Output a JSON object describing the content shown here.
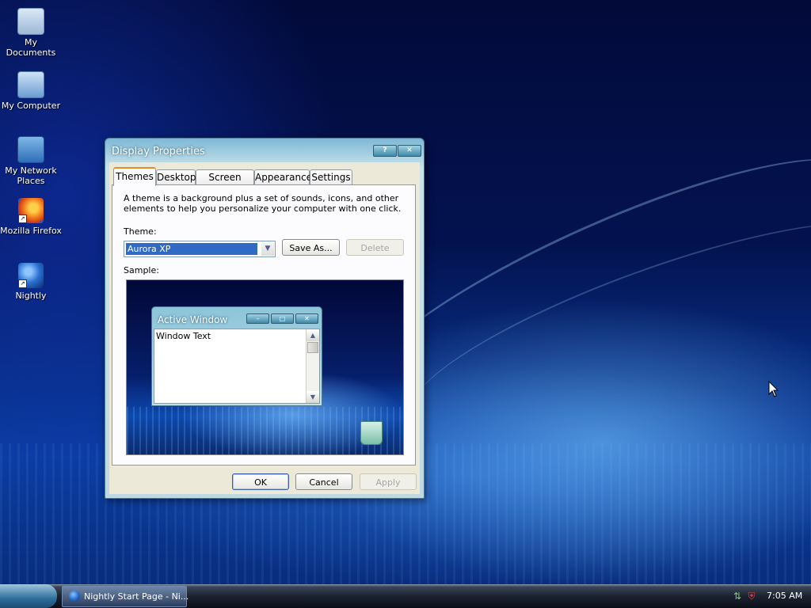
{
  "desktop": {
    "icons": [
      {
        "label": "My Documents",
        "icon": "folder-documents-icon"
      },
      {
        "label": "My Computer",
        "icon": "computer-icon"
      },
      {
        "label": "My Network Places",
        "icon": "network-places-icon"
      },
      {
        "label": "Mozilla Firefox",
        "icon": "firefox-icon"
      },
      {
        "label": "Nightly",
        "icon": "nightly-browser-icon"
      }
    ]
  },
  "dialog": {
    "title": "Display Properties",
    "help_button": "?",
    "close_button": "✕",
    "tabs": [
      {
        "label": "Themes",
        "active": true
      },
      {
        "label": "Desktop",
        "active": false
      },
      {
        "label": "Screen Saver",
        "active": false
      },
      {
        "label": "Appearance",
        "active": false
      },
      {
        "label": "Settings",
        "active": false
      }
    ],
    "description": "A theme is a background plus a set of sounds, icons, and other elements to help you personalize your computer with one click.",
    "theme_label": "Theme:",
    "theme_value": "Aurora XP",
    "save_as_label": "Save As...",
    "delete_label": "Delete",
    "sample_label": "Sample:",
    "sample_window": {
      "title": "Active Window",
      "text": "Window Text"
    },
    "ok_label": "OK",
    "cancel_label": "Cancel",
    "apply_label": "Apply"
  },
  "taskbar": {
    "task_label": "Nightly Start Page - Ni...",
    "clock": "7:05 AM",
    "tray_icons": [
      "network-icon",
      "security-shield-icon"
    ]
  },
  "colors": {
    "selection": "#316ac5",
    "tab_highlight": "#e68b2c",
    "dialog_face": "#ece9d8"
  }
}
